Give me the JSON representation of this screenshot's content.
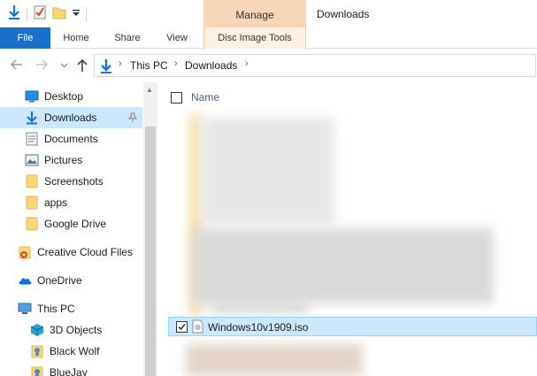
{
  "window": {
    "title": "Downloads",
    "context_group": "Manage"
  },
  "ribbon": {
    "tabs": [
      {
        "label": "File",
        "active": true
      },
      {
        "label": "Home"
      },
      {
        "label": "Share"
      },
      {
        "label": "View"
      },
      {
        "label": "Disc Image Tools",
        "contextual": true
      }
    ]
  },
  "address": {
    "breadcrumbs": [
      "This PC",
      "Downloads"
    ]
  },
  "nav_pane": {
    "quick_access": [
      {
        "label": "Desktop",
        "icon": "desktop-icon",
        "pinned": true
      },
      {
        "label": "Downloads",
        "icon": "download-arrow-icon",
        "pinned": true,
        "selected": true
      },
      {
        "label": "Documents",
        "icon": "documents-icon",
        "pinned": true
      },
      {
        "label": "Pictures",
        "icon": "pictures-icon",
        "pinned": true
      },
      {
        "label": "Screenshots",
        "icon": "folder-icon",
        "pinned": true
      },
      {
        "label": "apps",
        "icon": "folder-icon",
        "pinned": true
      },
      {
        "label": "Google Drive",
        "icon": "folder-icon",
        "pinned": true
      }
    ],
    "locations": [
      {
        "label": "Creative Cloud Files",
        "icon": "creative-cloud-folder-icon"
      },
      {
        "label": "OneDrive",
        "icon": "onedrive-cloud-icon"
      },
      {
        "label": "This PC",
        "icon": "computer-icon"
      }
    ],
    "this_pc_children": [
      {
        "label": "3D Objects",
        "icon": "3d-objects-icon"
      },
      {
        "label": "Black Wolf",
        "icon": "user-folder-icon"
      },
      {
        "label": "BlueJay",
        "icon": "user-folder-icon"
      }
    ]
  },
  "content": {
    "column_header": "Name",
    "selected_file": {
      "name": "Windows10v1909.iso",
      "checked": true
    }
  },
  "colors": {
    "accent": "#1a6fc8",
    "context_tab": "#f7d7b9",
    "selection": "#cce8ff",
    "folder": "#f8d775"
  }
}
